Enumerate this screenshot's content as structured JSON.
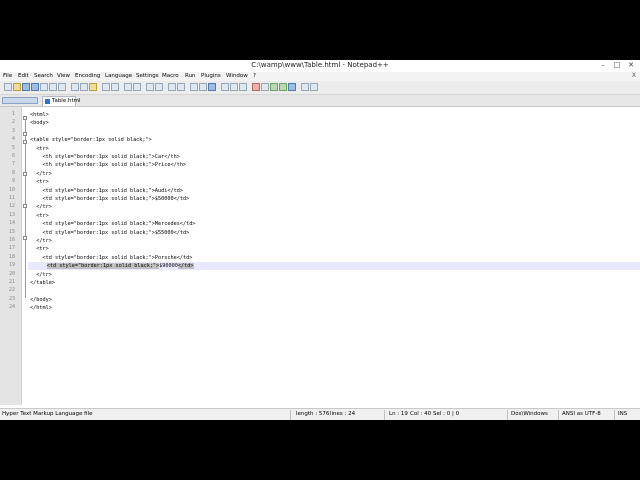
{
  "window": {
    "title": "C:\\wamp\\www\\Table.html - Notepad++"
  },
  "menu": [
    "File",
    "Edit",
    "Search",
    "View",
    "Encoding",
    "Language",
    "Settings",
    "Macro",
    "Run",
    "Plugins",
    "Window",
    "?"
  ],
  "menu_close": "X",
  "tab": {
    "label": "Table.html"
  },
  "code_lines": [
    "<html>",
    "<body>",
    "",
    "<table style=\"border:1px solid black;\">",
    "  <tr>",
    "    <th style=\"border:1px solid black;\">Car</th>",
    "    <th style=\"border:1px solid black;\">Price</th>",
    "  </tr>",
    "  <tr>",
    "    <td style=\"border:1px solid black;\">Audi</td>",
    "    <td style=\"border:1px solid black;\">$50000</td>",
    "  </tr>",
    "  <tr>",
    "    <td style=\"border:1px solid black;\">Mercedes</td>",
    "    <td style=\"border:1px solid black;\">$55000</td>",
    "  </tr>",
    "  <tr>",
    "    <td style=\"border:1px solid black;\">Porsche</td>",
    "    <td style=\"border:1px solid black;\">$90000</td>",
    "  </tr>",
    "</table>",
    "",
    "</body>",
    "</html>"
  ],
  "current_line": {
    "index": 18,
    "prefix": "    ",
    "selected": "<td style=\"border:1px solid black;\">",
    "text": "$90000",
    "suffix": "</td>"
  },
  "status": {
    "file_type": "Hyper Text Markup Language file",
    "length": "length : 576",
    "lines": "lines : 24",
    "ln": "Ln : 19",
    "col": "Col : 40",
    "sel": "Sel : 0 | 0",
    "eol": "Dos\\Windows",
    "encoding": "ANSI as UTF-8",
    "mode": "INS"
  }
}
